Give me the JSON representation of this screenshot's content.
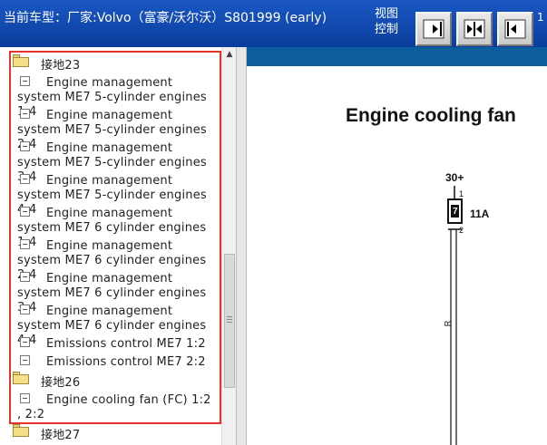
{
  "header": {
    "car_title": "当前车型：厂家:Volvo（富豪/沃尔沃）S801999 (early)",
    "view_label": "视图控制",
    "buttons": [
      {
        "icon": "nav-first-icon"
      },
      {
        "icon": "nav-middle-icon"
      },
      {
        "icon": "nav-back-icon"
      }
    ],
    "edge_glyph": "1"
  },
  "tree": {
    "items": [
      {
        "type": "folder",
        "label": "接地23"
      },
      {
        "type": "doc",
        "label": "Engine management system ME7 5-cylinder engines 1:4"
      },
      {
        "type": "doc",
        "label": "Engine management system ME7 5-cylinder engines 2:4"
      },
      {
        "type": "doc",
        "label": "Engine management system ME7 5-cylinder engines 3:4"
      },
      {
        "type": "doc",
        "label": "Engine management system ME7 5-cylinder engines 4:4"
      },
      {
        "type": "doc",
        "label": "Engine management system ME7 6 cylinder engines 1:4"
      },
      {
        "type": "doc",
        "label": "Engine management system ME7 6 cylinder engines 2:4"
      },
      {
        "type": "doc",
        "label": "Engine management system ME7 6 cylinder engines 3:4"
      },
      {
        "type": "doc",
        "label": "Engine management system ME7 6 cylinder engines 4:4"
      },
      {
        "type": "doc",
        "label": "Emissions control ME7 1:2"
      },
      {
        "type": "doc",
        "label": "Emissions control ME7 2:2"
      },
      {
        "type": "folder",
        "label": "接地26"
      },
      {
        "type": "doc",
        "label": "Engine cooling fan (FC) 1:2 , 2:2"
      },
      {
        "type": "folder",
        "label": "接地27"
      }
    ]
  },
  "diagram": {
    "title": "Engine cooling fan",
    "supply_label": "30+",
    "fuse_number": "7",
    "fuse_rating": "11A",
    "pin_top": "1",
    "pin_bottom": "2",
    "wire_color": "R",
    "header_color": "#0b5d9e"
  },
  "colors": {
    "topbar": "#0b43a8",
    "highlight_border": "#e0352b"
  }
}
